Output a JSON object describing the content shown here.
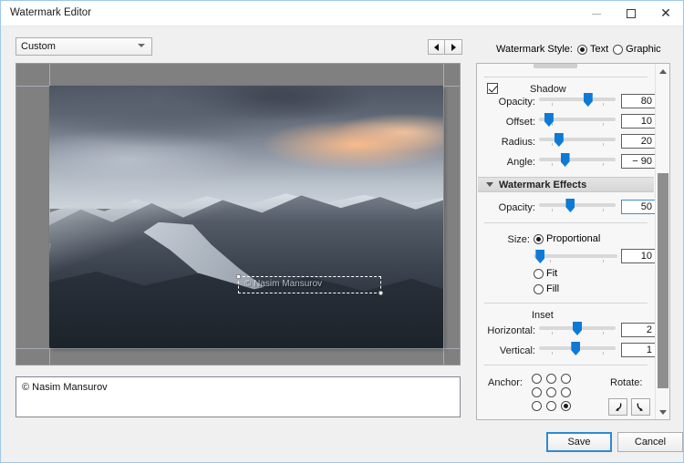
{
  "window": {
    "title": "Watermark Editor",
    "controls": {
      "minimize": "minimize-icon",
      "maximize": "maximize-icon",
      "close": "close-icon"
    }
  },
  "toolbar": {
    "preset_value": "Custom",
    "preset_caret": "chevron-down-icon",
    "prev_label": "prev-arrow-icon",
    "next_label": "next-arrow-icon",
    "watermark_style_label": "Watermark Style:",
    "style_options": [
      {
        "label": "Text",
        "selected": true
      },
      {
        "label": "Graphic",
        "selected": false
      }
    ]
  },
  "preview": {
    "watermark_overlay_text": "© Nasim Mansurov"
  },
  "text_entry": {
    "value": "© Nasim Mansurov"
  },
  "panel": {
    "shadow": {
      "checkbox_checked": true,
      "title": "Shadow",
      "rows": [
        {
          "label": "Opacity:",
          "value": "80",
          "pos": 64
        },
        {
          "label": "Offset:",
          "value": "10",
          "pos": 13
        },
        {
          "label": "Radius:",
          "value": "20",
          "pos": 26
        },
        {
          "label": "Angle:",
          "value": "− 90",
          "pos": 34
        }
      ]
    },
    "effects": {
      "title": "Watermark Effects",
      "collapse_icon": "triangle-down-icon",
      "opacity": {
        "label": "Opacity:",
        "value": "50",
        "pos": 41
      },
      "size": {
        "label": "Size:",
        "options": [
          {
            "label": "Proportional",
            "selected": true
          },
          {
            "label": "Fit",
            "selected": false
          },
          {
            "label": "Fill",
            "selected": false
          }
        ],
        "value": "10",
        "pos": 8
      },
      "inset": {
        "title": "Inset",
        "rows": [
          {
            "label": "Horizontal:",
            "value": "2",
            "pos": 50
          },
          {
            "label": "Vertical:",
            "value": "1",
            "pos": 48
          }
        ]
      },
      "anchor": {
        "label": "Anchor:",
        "selected_index": 8
      },
      "rotate": {
        "label": "Rotate:",
        "buttons": [
          "rotate-ccw-icon",
          "rotate-cw-icon"
        ]
      }
    },
    "scrollbar": {
      "up": "scroll-up-icon",
      "down": "scroll-down-icon"
    }
  },
  "footer": {
    "save_label": "Save",
    "cancel_label": "Cancel"
  },
  "colors": {
    "accent": "#0d7ad6",
    "focus": "#2e8ad3",
    "panel_bg": "#f7f7f7",
    "preview_bg": "#808080"
  }
}
